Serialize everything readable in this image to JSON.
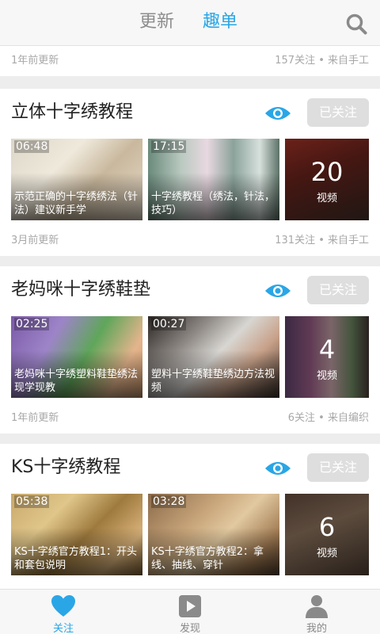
{
  "header": {
    "tabs": [
      {
        "label": "更新",
        "active": false
      },
      {
        "label": "趣单",
        "active": true
      }
    ],
    "search_icon": "search-icon"
  },
  "top_meta": {
    "left": "1年前更新",
    "right": "157关注 • 来自手工"
  },
  "cards": [
    {
      "title": "立体十字绣教程",
      "follow_label": "已关注",
      "videos": [
        {
          "duration": "06:48",
          "title": "示范正确的十字绣绣法（针法）建议新手学"
        },
        {
          "duration": "17:15",
          "title": "十字绣教程（绣法，针法，技巧）"
        }
      ],
      "count": "20",
      "count_label": "视频",
      "meta_left": "3月前更新",
      "meta_right": "131关注 • 来自手工"
    },
    {
      "title": "老妈咪十字绣鞋垫",
      "follow_label": "已关注",
      "videos": [
        {
          "duration": "02:25",
          "title": "老妈咪十字绣塑料鞋垫绣法现学现教"
        },
        {
          "duration": "00:27",
          "title": "塑料十字绣鞋垫绣边方法视频"
        }
      ],
      "count": "4",
      "count_label": "视频",
      "meta_left": "1年前更新",
      "meta_right": "6关注 • 来自编织"
    },
    {
      "title": "KS十字绣教程",
      "follow_label": "已关注",
      "videos": [
        {
          "duration": "05:38",
          "title": "KS十字绣官方教程1：开头和套包说明"
        },
        {
          "duration": "03:28",
          "title": "KS十字绣官方教程2：拿线、抽线、穿针"
        }
      ],
      "count": "6",
      "count_label": "视频",
      "meta_left": "",
      "meta_right": ""
    }
  ],
  "bottom_nav": [
    {
      "label": "关注",
      "icon": "heart-icon",
      "active": true
    },
    {
      "label": "发现",
      "icon": "play-icon",
      "active": false
    },
    {
      "label": "我的",
      "icon": "user-icon",
      "active": false
    }
  ],
  "colors": {
    "accent": "#2aa6e6",
    "follow_button": "#dedede"
  }
}
